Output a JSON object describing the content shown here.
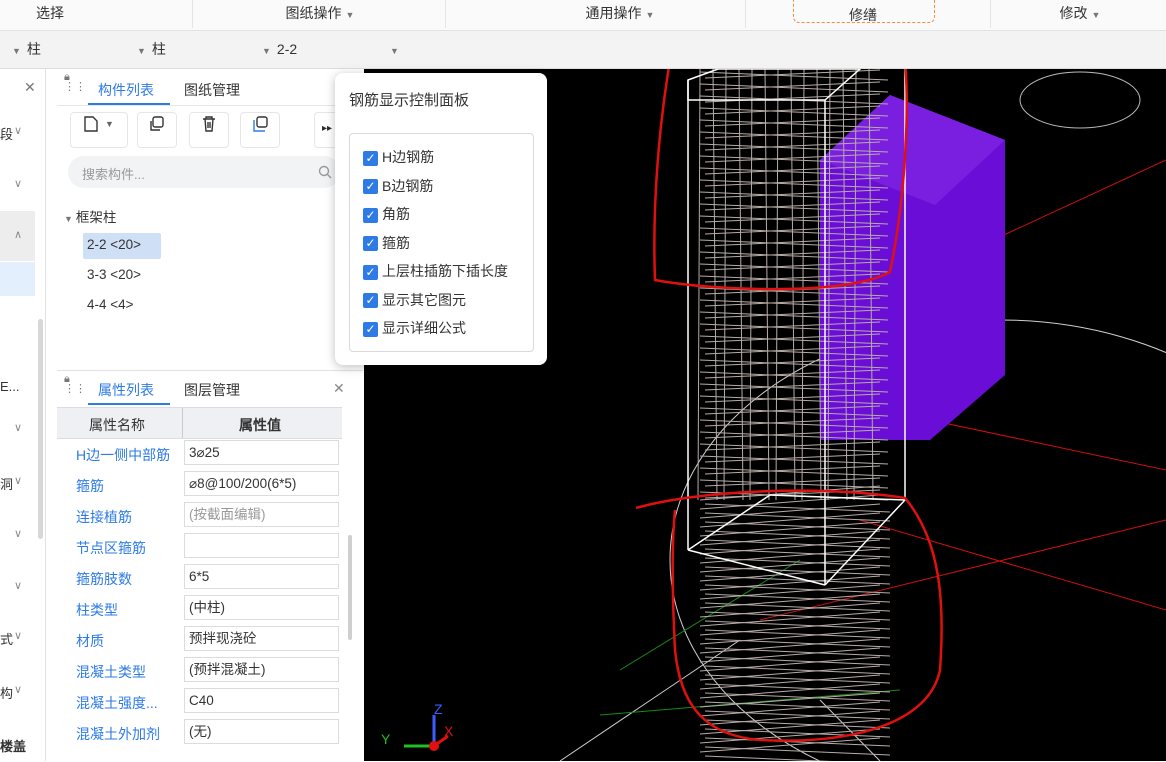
{
  "ribbon": {
    "select": "选择",
    "drawing_ops": "图纸操作",
    "general_ops": "通用操作",
    "trim": "修缮",
    "modify": "修改"
  },
  "toolbar2": {
    "sel1": "柱",
    "sel2": "柱",
    "sel3": "2-2"
  },
  "strip": {
    "item1": "段",
    "item2": "E...",
    "item3": "洞",
    "item4": "式",
    "item5": "构",
    "item6": "楼盖"
  },
  "component_panel": {
    "tab_list": "构件列表",
    "tab_drawing": "图纸管理",
    "search_placeholder": "搜索构件...",
    "tree_group": "框架柱",
    "items": [
      {
        "label": "2-2 <20>"
      },
      {
        "label": "3-3 <20>"
      },
      {
        "label": "4-4 <4>"
      }
    ]
  },
  "property_panel": {
    "tab_props": "属性列表",
    "tab_layers": "图层管理",
    "col_name": "属性名称",
    "col_value": "属性值",
    "rows": [
      {
        "name": "H边一侧中部筋",
        "value": "3⌀25"
      },
      {
        "name": "箍筋",
        "value": "⌀8@100/200(6*5)"
      },
      {
        "name": "连接植筋",
        "value": "(按截面编辑)"
      },
      {
        "name": "节点区箍筋",
        "value": ""
      },
      {
        "name": "箍筋肢数",
        "value": "6*5"
      },
      {
        "name": "柱类型",
        "value": "(中柱)"
      },
      {
        "name": "材质",
        "value": "预拌现浇砼"
      },
      {
        "name": "混凝土类型",
        "value": "(预拌混凝土)"
      },
      {
        "name": "混凝土强度...",
        "value": "C40"
      },
      {
        "name": "混凝土外加剂",
        "value": "(无)"
      }
    ]
  },
  "rebar_panel": {
    "title": "钢筋显示控制面板",
    "options": [
      {
        "label": "H边钢筋",
        "checked": true
      },
      {
        "label": "B边钢筋",
        "checked": true
      },
      {
        "label": "角筋",
        "checked": true
      },
      {
        "label": "箍筋",
        "checked": true
      },
      {
        "label": "上层柱插筋下插长度",
        "checked": true
      },
      {
        "label": "显示其它图元",
        "checked": true
      },
      {
        "label": "显示详细公式",
        "checked": true
      }
    ]
  },
  "axis": {
    "x": "X",
    "y": "Y",
    "z": "Z"
  },
  "colors": {
    "accent": "#2e7be6",
    "slab": "#6a0dd6",
    "annotation": "#e01010",
    "rebar": "#b8aca8"
  }
}
